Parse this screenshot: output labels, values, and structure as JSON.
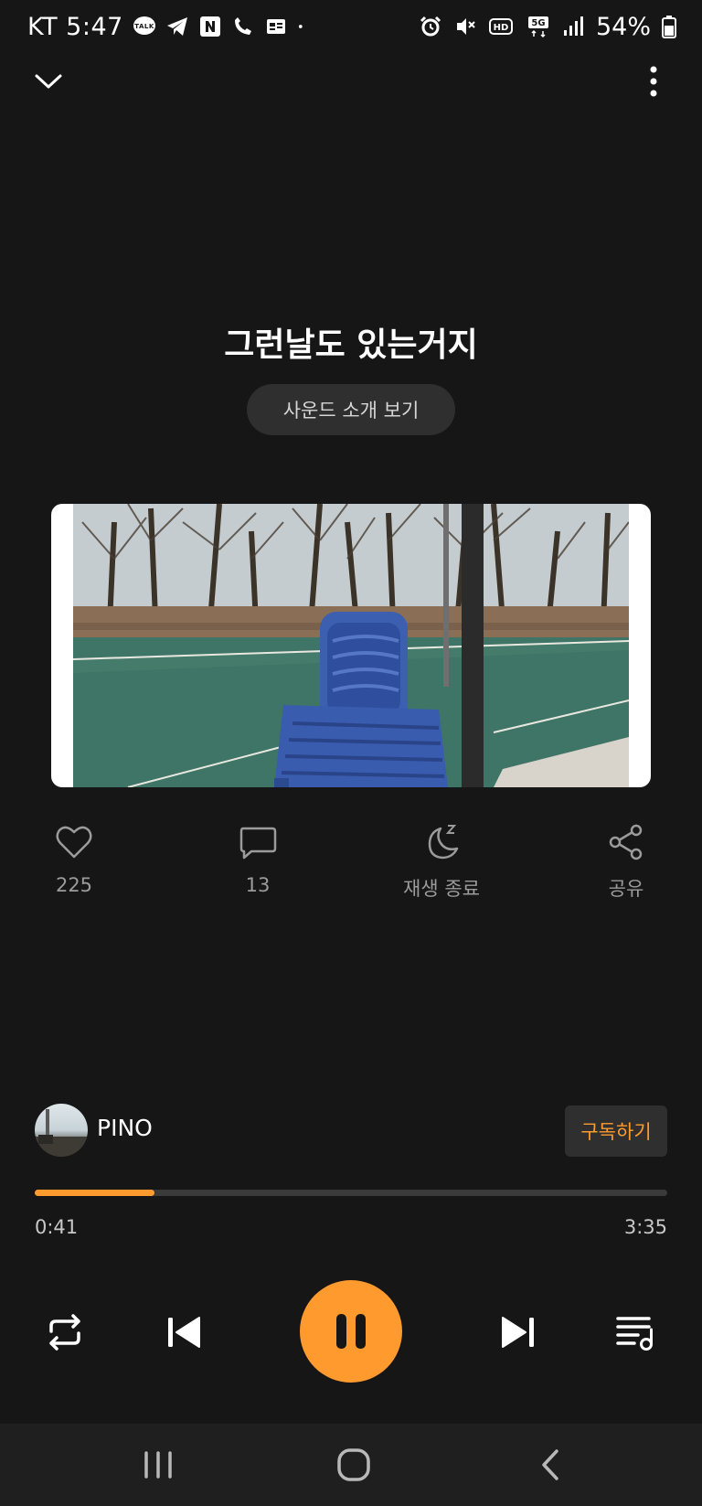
{
  "status_bar": {
    "carrier_time": "KT 5:47",
    "network": "5G",
    "hd_badge": "HD",
    "battery": "54%",
    "left_icons": [
      "kakaotalk-icon",
      "telegram-icon",
      "naver-icon",
      "whowho-icon",
      "gallery-icon",
      "dot-icon"
    ],
    "right_icons": [
      "alarm-icon",
      "mute-icon",
      "hd-voice-icon",
      "5g-icon",
      "signal-icon",
      "battery-icon"
    ]
  },
  "track": {
    "title": "그런날도 있는거지",
    "intro_button_label": "사운드 소개 보기"
  },
  "actions": {
    "like_count": "225",
    "comment_count": "13",
    "sleep_timer_label": "재생 종료",
    "share_label": "공유"
  },
  "artist": {
    "name": "PINO",
    "subscribe_label": "구독하기"
  },
  "playback": {
    "current_time": "0:41",
    "total_time": "3:35",
    "progress": 0.19,
    "state": "playing"
  },
  "colors": {
    "accent": "#ff9a2e",
    "background": "#161616",
    "button_bg": "#2f2f2f"
  }
}
